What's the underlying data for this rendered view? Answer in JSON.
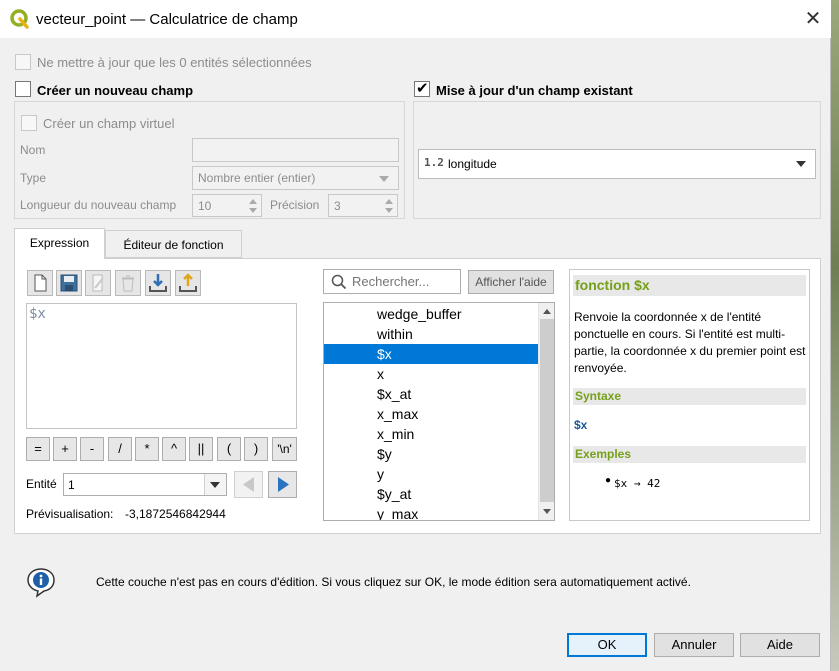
{
  "window": {
    "title": "vecteur_point — Calculatrice de champ",
    "close_icon": "✕"
  },
  "top": {
    "only_selected_label": "Ne mettre à jour que les 0 entités sélectionnées"
  },
  "new_field": {
    "checkbox_label": "Créer un nouveau champ",
    "virtual_label": "Créer un champ virtuel",
    "name_label": "Nom",
    "name_value": "",
    "type_label": "Type",
    "type_value": "Nombre entier (entier)",
    "length_label": "Longueur du nouveau champ",
    "length_value": "10",
    "precision_label": "Précision",
    "precision_value": "3"
  },
  "update_field": {
    "checkbox_label": "Mise à jour d'un champ existant",
    "checked": true,
    "field_type_badge": "1.2",
    "field_value": "longitude"
  },
  "tabs": [
    {
      "label": "Expression"
    },
    {
      "label": "Éditeur de fonction"
    }
  ],
  "expression": {
    "text": "$x",
    "operators": [
      "=",
      "+",
      "-",
      "/",
      "*",
      "^",
      "||",
      "(",
      ")",
      "'\\n'"
    ],
    "entity_label": "Entité",
    "entity_value": "1",
    "preview_label": "Prévisualisation:",
    "preview_value": "-3,1872546842944"
  },
  "functions": {
    "search_placeholder": "Rechercher...",
    "show_help_label": "Afficher l'aide",
    "items": [
      {
        "label": "wedge_buffer"
      },
      {
        "label": "within"
      },
      {
        "label": "$x"
      },
      {
        "label": "x"
      },
      {
        "label": "$x_at"
      },
      {
        "label": "x_max"
      },
      {
        "label": "x_min"
      },
      {
        "label": "$y"
      },
      {
        "label": "y"
      },
      {
        "label": "$y_at"
      },
      {
        "label": "y_max"
      }
    ],
    "selected_index": 2
  },
  "help": {
    "title": "fonction $x",
    "description": "Renvoie la coordonnée x de l'entité ponctuelle en cours. Si l'entité est multi-partie, la coordonnée x du premier point est renvoyée.",
    "syntax_heading": "Syntaxe",
    "syntax": "$x",
    "examples_heading": "Exemples",
    "example": "$x → 42"
  },
  "message": {
    "text": "Cette couche n'est pas en cours d'édition. Si vous cliquez sur OK, le mode édition sera automatiquement activé."
  },
  "buttons": {
    "ok": "OK",
    "cancel": "Annuler",
    "help": "Aide"
  },
  "colors": {
    "selection": "#0078d7",
    "help_heading": "#77a01a",
    "syntax": "#1c5a96"
  }
}
